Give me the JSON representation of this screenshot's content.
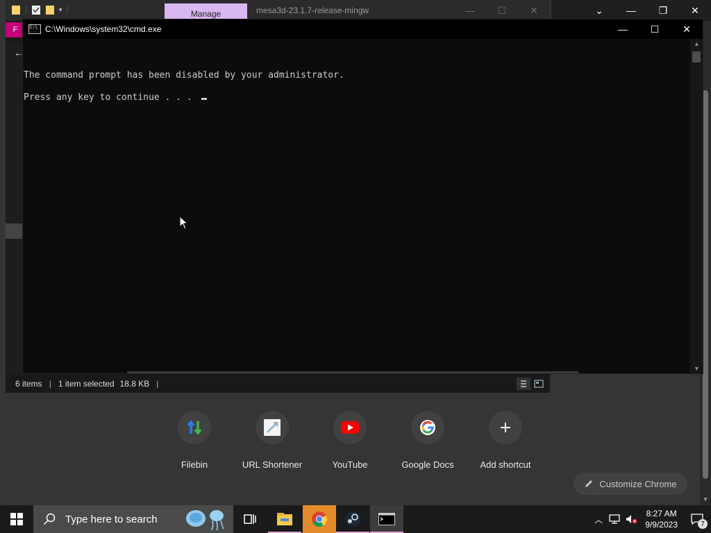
{
  "explorer": {
    "manage_label": "Manage",
    "title": "mesa3d-23.1.7-release-mingw",
    "ribbon_tab": "F",
    "status": {
      "items": "6 items",
      "selected": "1 item selected",
      "size": "18.8 KB"
    }
  },
  "cmd": {
    "title": "C:\\Windows\\system32\\cmd.exe",
    "lines": [
      "The command prompt has been disabled by your administrator.",
      "Press any key to continue . . . "
    ]
  },
  "chrome": {
    "shortcuts": [
      {
        "label": "Filebin",
        "icon": "filebin-icon"
      },
      {
        "label": "URL Shortener",
        "icon": "url-shortener-icon"
      },
      {
        "label": "YouTube",
        "icon": "youtube-icon"
      },
      {
        "label": "Google Docs",
        "icon": "google-icon"
      },
      {
        "label": "Add shortcut",
        "icon": "plus-icon"
      }
    ],
    "customize_label": "Customize Chrome"
  },
  "taskbar": {
    "search_placeholder": "Type here to search",
    "time": "8:27 AM",
    "date": "9/9/2023",
    "notification_count": "7"
  }
}
